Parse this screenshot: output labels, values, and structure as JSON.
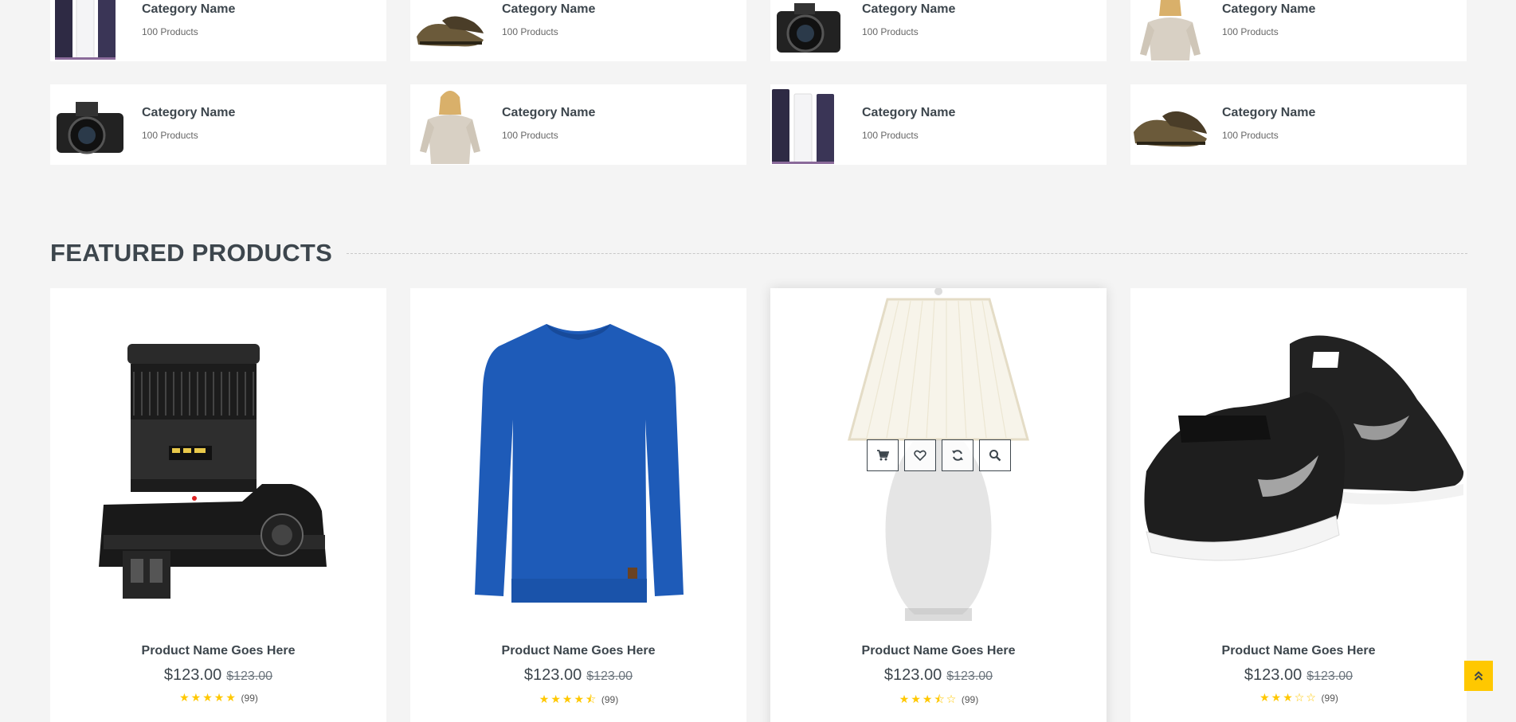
{
  "categories": [
    {
      "name": "Category Name",
      "count": "100 Products",
      "thumb": "cosmetics-icon"
    },
    {
      "name": "Category Name",
      "count": "100 Products",
      "thumb": "shoes-icon"
    },
    {
      "name": "Category Name",
      "count": "100 Products",
      "thumb": "camera-icon"
    },
    {
      "name": "Category Name",
      "count": "100 Products",
      "thumb": "sweater-woman-icon"
    },
    {
      "name": "Category Name",
      "count": "100 Products",
      "thumb": "camera-icon"
    },
    {
      "name": "Category Name",
      "count": "100 Products",
      "thumb": "sweater-woman-icon"
    },
    {
      "name": "Category Name",
      "count": "100 Products",
      "thumb": "cosmetics-icon"
    },
    {
      "name": "Category Name",
      "count": "100 Products",
      "thumb": "shoes-icon"
    }
  ],
  "featured": {
    "title": "FEATURED PRODUCTS"
  },
  "products": [
    {
      "name": "Product Name Goes Here",
      "price": "$123.00",
      "old_price": "$123.00",
      "rating": 5,
      "reviews": "(99)",
      "image": "camera"
    },
    {
      "name": "Product Name Goes Here",
      "price": "$123.00",
      "old_price": "$123.00",
      "rating": 4.5,
      "reviews": "(99)",
      "image": "sweater"
    },
    {
      "name": "Product Name Goes Here",
      "price": "$123.00",
      "old_price": "$123.00",
      "rating": 3.5,
      "reviews": "(99)",
      "image": "lamp"
    },
    {
      "name": "Product Name Goes Here",
      "price": "$123.00",
      "old_price": "$123.00",
      "rating": 3,
      "reviews": "(99)",
      "image": "sneakers"
    }
  ],
  "colors": {
    "accent": "#ffc800",
    "text": "#3d464d",
    "background": "#f4f4f4"
  }
}
